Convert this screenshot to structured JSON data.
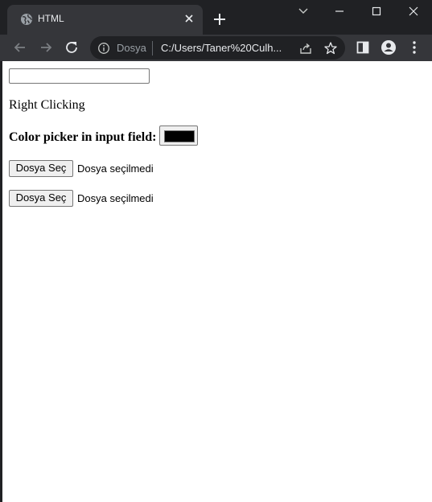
{
  "browser": {
    "tab": {
      "title": "HTML",
      "favicon": "globe-icon"
    },
    "address_bar": {
      "security_chip": "Dosya",
      "url": "C:/Users/Taner%20Culh..."
    }
  },
  "page": {
    "text_input_value": "",
    "right_click_text": "Right Clicking",
    "color_picker": {
      "label": "Color picker in input field:",
      "value": "#000000"
    },
    "file_inputs": [
      {
        "button_label": "Dosya Seç",
        "status": "Dosya seçilmedi"
      },
      {
        "button_label": "Dosya Seç",
        "status": "Dosya seçilmedi"
      }
    ]
  },
  "colors": {
    "tabstrip_bg": "#202124",
    "toolbar_bg": "#35363a",
    "page_bg": "#ffffff"
  }
}
